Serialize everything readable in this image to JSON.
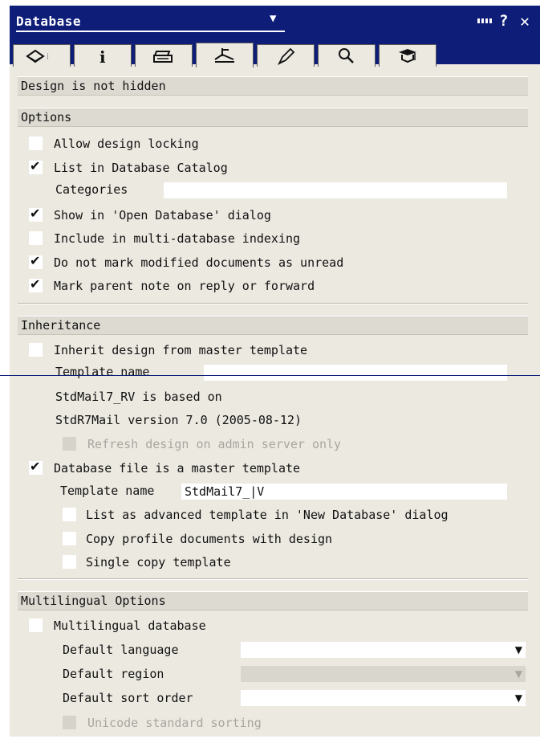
{
  "window": {
    "title": "Database"
  },
  "tabs": [
    {
      "icon": "info-book-icon"
    },
    {
      "icon": "info-icon"
    },
    {
      "icon": "printer-icon"
    },
    {
      "icon": "design-ruler-icon",
      "active": true
    },
    {
      "icon": "launch-pen-icon"
    },
    {
      "icon": "search-icon"
    },
    {
      "icon": "advanced-hat-icon"
    }
  ],
  "design_status": "Design is not hidden",
  "options": {
    "header": "Options",
    "allow_design_locking": {
      "label": "Allow design locking",
      "checked": false
    },
    "list_in_catalog": {
      "label": "List in Database Catalog",
      "checked": true
    },
    "categories": {
      "label": "Categories",
      "value": ""
    },
    "show_in_open_dialog": {
      "label": "Show in 'Open Database' dialog",
      "checked": true
    },
    "multi_db_indexing": {
      "label": "Include in multi-database indexing",
      "checked": false
    },
    "do_not_mark_unread": {
      "label": "Do not mark modified documents as unread",
      "checked": true
    },
    "mark_parent_note": {
      "label": "Mark parent note on reply or forward",
      "checked": true
    }
  },
  "inheritance": {
    "header": "Inheritance",
    "inherit_from_master": {
      "label": "Inherit design from master template",
      "checked": false
    },
    "template_name_1": {
      "label": "Template name",
      "value": ""
    },
    "based_on_line1": "StdMail7_RV is based on",
    "based_on_line2": "StdR7Mail version 7.0 (2005-08-12)",
    "refresh_admin_only": {
      "label": "Refresh design on admin server only",
      "checked": false,
      "disabled": true
    },
    "is_master_template": {
      "label": "Database file is a master template",
      "checked": true
    },
    "template_name_2": {
      "label": "Template name",
      "value": "StdMail7_|V"
    },
    "list_advanced": {
      "label": "List as advanced template in 'New Database' dialog",
      "checked": false
    },
    "copy_profile_docs": {
      "label": "Copy profile documents with design",
      "checked": false
    },
    "single_copy": {
      "label": "Single copy template",
      "checked": false
    }
  },
  "multilingual": {
    "header": "Multilingual Options",
    "multilingual_db": {
      "label": "Multilingual database",
      "checked": false
    },
    "default_language": {
      "label": "Default language",
      "value": ""
    },
    "default_region": {
      "label": "Default region",
      "value": ""
    },
    "default_sort_order": {
      "label": "Default sort order",
      "value": ""
    },
    "unicode_sorting": {
      "label": "Unicode standard sorting",
      "checked": false,
      "disabled": true
    }
  },
  "colors": {
    "titlebar": "#0d1d78",
    "panel": "#ece9e1"
  }
}
